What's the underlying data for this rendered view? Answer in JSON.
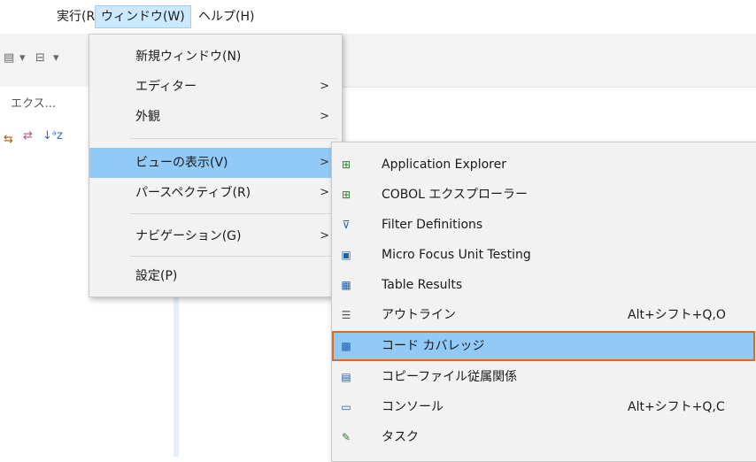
{
  "menubar": [
    {
      "label": "実行(R)"
    },
    {
      "label": "ウィンドウ(W)"
    },
    {
      "label": "ヘルプ(H)"
    }
  ],
  "search_label": "エクス...",
  "window_menu": {
    "items": [
      {
        "label": "新規ウィンドウ(N)",
        "submenu": false
      },
      {
        "label": "エディター",
        "submenu": true
      },
      {
        "label": "外観",
        "submenu": true
      },
      {
        "label": "ビューの表示(V)",
        "submenu": true,
        "highlighted": true
      },
      {
        "label": "パースペクティブ(R)",
        "submenu": true
      },
      {
        "label": "ナビゲーション(G)",
        "submenu": true
      },
      {
        "label": "設定(P)",
        "submenu": false
      }
    ],
    "arrow": ">"
  },
  "view_submenu": {
    "items": [
      {
        "label": "Application Explorer",
        "icon": "application-explorer-icon",
        "shortcut": ""
      },
      {
        "label": "COBOL エクスプローラー",
        "icon": "cobol-explorer-icon",
        "shortcut": ""
      },
      {
        "label": "Filter Definitions",
        "icon": "filter-icon",
        "shortcut": ""
      },
      {
        "label": "Micro Focus Unit Testing",
        "icon": "unit-testing-icon",
        "shortcut": ""
      },
      {
        "label": "Table Results",
        "icon": "table-results-icon",
        "shortcut": ""
      },
      {
        "label": "アウトライン",
        "icon": "outline-icon",
        "shortcut": "Alt+シフト+Q,O"
      },
      {
        "label": "コード カバレッジ",
        "icon": "code-coverage-icon",
        "shortcut": "",
        "selected": true
      },
      {
        "label": "コピーファイル従属関係",
        "icon": "copyfile-dependency-icon",
        "shortcut": ""
      },
      {
        "label": "コンソール",
        "icon": "console-icon",
        "shortcut": "Alt+シフト+Q,C"
      },
      {
        "label": "タスク",
        "icon": "task-icon",
        "shortcut": ""
      }
    ]
  }
}
